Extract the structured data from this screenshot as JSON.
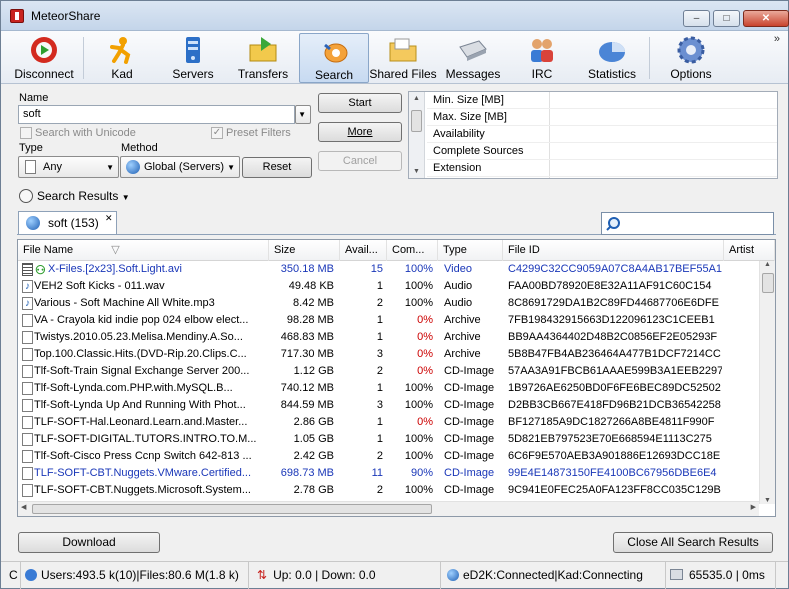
{
  "window": {
    "title": "MeteorShare"
  },
  "toolbar": {
    "items": [
      {
        "label": "Disconnect",
        "icon": "disconnect-icon"
      },
      {
        "label": "Kad",
        "icon": "kad-icon"
      },
      {
        "label": "Servers",
        "icon": "servers-icon"
      },
      {
        "label": "Transfers",
        "icon": "transfers-icon"
      },
      {
        "label": "Search",
        "icon": "search-icon"
      },
      {
        "label": "Shared Files",
        "icon": "shared-files-icon"
      },
      {
        "label": "Messages",
        "icon": "messages-icon"
      },
      {
        "label": "IRC",
        "icon": "irc-icon"
      },
      {
        "label": "Statistics",
        "icon": "statistics-icon"
      },
      {
        "label": "Options",
        "icon": "options-icon"
      }
    ],
    "overflow": "»"
  },
  "search": {
    "name_label": "Name",
    "name_value": "soft",
    "unicode_label": "Search with Unicode",
    "preset_label": "Preset Filters",
    "type_label": "Type",
    "type_value": "Any",
    "method_label": "Method",
    "method_value": "Global (Servers)",
    "start": "Start",
    "more": "More",
    "cancel": "Cancel",
    "reset": "Reset"
  },
  "filters": [
    "Min. Size [MB]",
    "Max. Size [MB]",
    "Availability",
    "Complete Sources",
    "Extension"
  ],
  "results": {
    "header": "Search Results",
    "tab_label": "soft (153)",
    "columns": [
      "File Name",
      "Size",
      "Avail...",
      "Com...",
      "Type",
      "File ID",
      "Artist"
    ],
    "rows": [
      {
        "name": "X-Files.[2x23].Soft.Light.avi",
        "size": "350.18 MB",
        "avail": "15",
        "comp": "100%",
        "type": "Video",
        "id": "C4299C32CC9059A07C8A4AB17BEF55A1",
        "color": "#1a37b8",
        "icon": "video",
        "compColor": "#1a37b8"
      },
      {
        "name": "VEH2 Soft Kicks - 011.wav",
        "size": "49.48 KB",
        "avail": "1",
        "comp": "100%",
        "type": "Audio",
        "id": "FAA00BD78920E8E32A11AF91C60C154",
        "color": "#000000",
        "icon": "audio",
        "compColor": "#000000"
      },
      {
        "name": "Various - Soft Machine All White.mp3",
        "size": "8.42 MB",
        "avail": "2",
        "comp": "100%",
        "type": "Audio",
        "id": "8C8691729DA1B2C89FD44687706E6DFE",
        "color": "#000000",
        "icon": "audio",
        "compColor": "#000000"
      },
      {
        "name": "VA - Crayola kid indie pop 024 elbow elect...",
        "size": "98.28 MB",
        "avail": "1",
        "comp": "0%",
        "type": "Archive",
        "id": "7FB198432915663D122096123C1CEEB1",
        "color": "#000000",
        "icon": "file",
        "compColor": "#cc0000"
      },
      {
        "name": "Twistys.2010.05.23.Melisa.Mendiny.A.So...",
        "size": "468.83 MB",
        "avail": "1",
        "comp": "0%",
        "type": "Archive",
        "id": "BB9AA4364402D48B2C0856EF2E05293F",
        "color": "#000000",
        "icon": "file",
        "compColor": "#cc0000"
      },
      {
        "name": "Top.100.Classic.Hits.(DVD-Rip.20.Clips.C...",
        "size": "717.30 MB",
        "avail": "3",
        "comp": "0%",
        "type": "Archive",
        "id": "5B8B47FB4AB236464A477B1DCF7214CC",
        "color": "#000000",
        "icon": "file",
        "compColor": "#cc0000"
      },
      {
        "name": "Tlf-Soft-Train Signal Exchange Server 200...",
        "size": "1.12 GB",
        "avail": "2",
        "comp": "0%",
        "type": "CD-Image",
        "id": "57AA3A91FBCB61AAAE599B3A1EEB2297",
        "color": "#000000",
        "icon": "file",
        "compColor": "#cc0000"
      },
      {
        "name": "Tlf-Soft-Lynda.com.PHP.with.MySQL.B...",
        "size": "740.12 MB",
        "avail": "1",
        "comp": "100%",
        "type": "CD-Image",
        "id": "1B9726AE6250BD0F6FE6BEC89DC52502",
        "color": "#000000",
        "icon": "file",
        "compColor": "#000000"
      },
      {
        "name": "Tlf-Soft-Lynda Up And Running With Phot...",
        "size": "844.59 MB",
        "avail": "3",
        "comp": "100%",
        "type": "CD-Image",
        "id": "D2BB3CB667E418FD96B21DCB36542258",
        "color": "#000000",
        "icon": "file",
        "compColor": "#000000"
      },
      {
        "name": "TLF-SOFT-Hal.Leonard.Learn.and.Master...",
        "size": "2.86 GB",
        "avail": "1",
        "comp": "0%",
        "type": "CD-Image",
        "id": "BF127185A9DC1827266A8BE4811F990F",
        "color": "#000000",
        "icon": "file",
        "compColor": "#cc0000"
      },
      {
        "name": "TLF-SOFT-DIGITAL.TUTORS.INTRO.TO.M...",
        "size": "1.05 GB",
        "avail": "1",
        "comp": "100%",
        "type": "CD-Image",
        "id": "5D821EB797523E70E668594E1113C275",
        "color": "#000000",
        "icon": "file",
        "compColor": "#000000"
      },
      {
        "name": "Tlf-Soft-Cisco Press Ccnp Switch 642-813 ...",
        "size": "2.42 GB",
        "avail": "2",
        "comp": "100%",
        "type": "CD-Image",
        "id": "6C6F9E570AEB3A901886E12693DCC18E",
        "color": "#000000",
        "icon": "file",
        "compColor": "#000000"
      },
      {
        "name": "TLF-SOFT-CBT.Nuggets.VMware.Certified...",
        "size": "698.73 MB",
        "avail": "11",
        "comp": "90%",
        "type": "CD-Image",
        "id": "99E4E14873150FE4100BC67956DBE6E4",
        "color": "#1a37b8",
        "icon": "file",
        "compColor": "#1a37b8"
      },
      {
        "name": "TLF-SOFT-CBT.Nuggets.Microsoft.System...",
        "size": "2.78 GB",
        "avail": "2",
        "comp": "100%",
        "type": "CD-Image",
        "id": "9C941E0FEC25A0FA123FF8CC035C129B",
        "color": "#000000",
        "icon": "file",
        "compColor": "#000000"
      }
    ]
  },
  "bottom": {
    "download": "Download",
    "close_all": "Close All Search Results"
  },
  "status": {
    "c": "C",
    "users": "Users:493.5 k(10)|Files:80.6 M(1.8 k)",
    "rate": "Up: 0.0 | Down: 0.0",
    "network": "eD2K:Connected|Kad:Connecting",
    "speed": "65535.0 | 0ms"
  }
}
